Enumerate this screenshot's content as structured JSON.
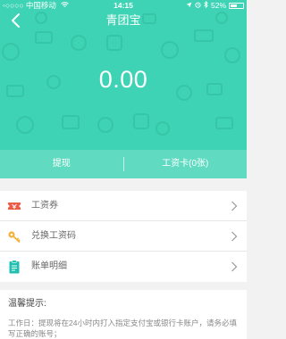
{
  "status_bar": {
    "carrier": "◦○○○○ 中国移动",
    "network": "WiFi",
    "time": "14:15",
    "battery_text": "52%",
    "battery_level": 0.52
  },
  "header": {
    "title": "青团宝"
  },
  "balance": {
    "amount": "0.00"
  },
  "actions": {
    "withdraw_label": "提现",
    "salary_card_label": "工资卡(0张)"
  },
  "menu": {
    "items": [
      {
        "label": "工资券",
        "icon": "ticket-icon"
      },
      {
        "label": "兑换工资码",
        "icon": "key-icon"
      },
      {
        "label": "账单明细",
        "icon": "clipboard-icon"
      }
    ]
  },
  "tips": {
    "title": "温馨提示:",
    "body": "工作日：提现将在24小时内打入指定支付宝或银行卡账户，请务必填写正确的账号；"
  },
  "colors": {
    "brand": "#3ed3b4",
    "ticket": "#ef5a47",
    "key": "#f3b23a",
    "clipboard": "#1fbfb1"
  }
}
